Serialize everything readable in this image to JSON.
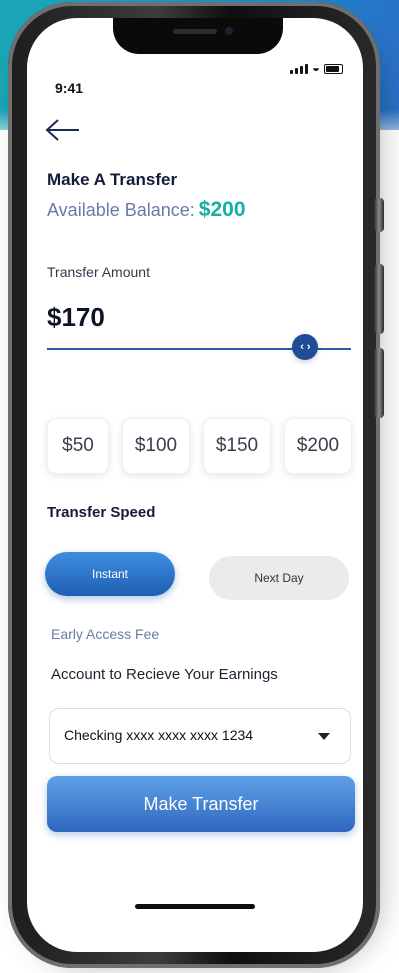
{
  "status_bar": {
    "time": "9:41"
  },
  "header": {
    "title": "Make A Transfer",
    "balance_label": "Available Balance:",
    "balance_value": "$200"
  },
  "transfer": {
    "amount_label": "Transfer Amount",
    "amount_value": "$170",
    "slider_fraction": 0.85,
    "thumb_glyph": "‹ ›",
    "quick_amounts": [
      "$50",
      "$100",
      "$150",
      "$200"
    ]
  },
  "speed": {
    "label": "Transfer Speed",
    "options": [
      "Instant",
      "Next Day"
    ],
    "selected": "Instant"
  },
  "fee": {
    "label": "Early Access Fee"
  },
  "account": {
    "label": "Account to Recieve Your Earnings",
    "selected": "Checking xxxx xxxx xxxx 1234"
  },
  "actions": {
    "make_transfer": "Make Transfer"
  },
  "colors": {
    "primary": "#2f67bf",
    "accent_teal": "#15b0a3",
    "muted_text": "#6a7aa8",
    "background_banner": "#1b8fd0"
  },
  "icons": {
    "back": "back-arrow-icon",
    "signal": "signal-icon",
    "wifi": "wifi-icon",
    "battery": "battery-icon",
    "dropdown": "chevron-down-icon"
  }
}
